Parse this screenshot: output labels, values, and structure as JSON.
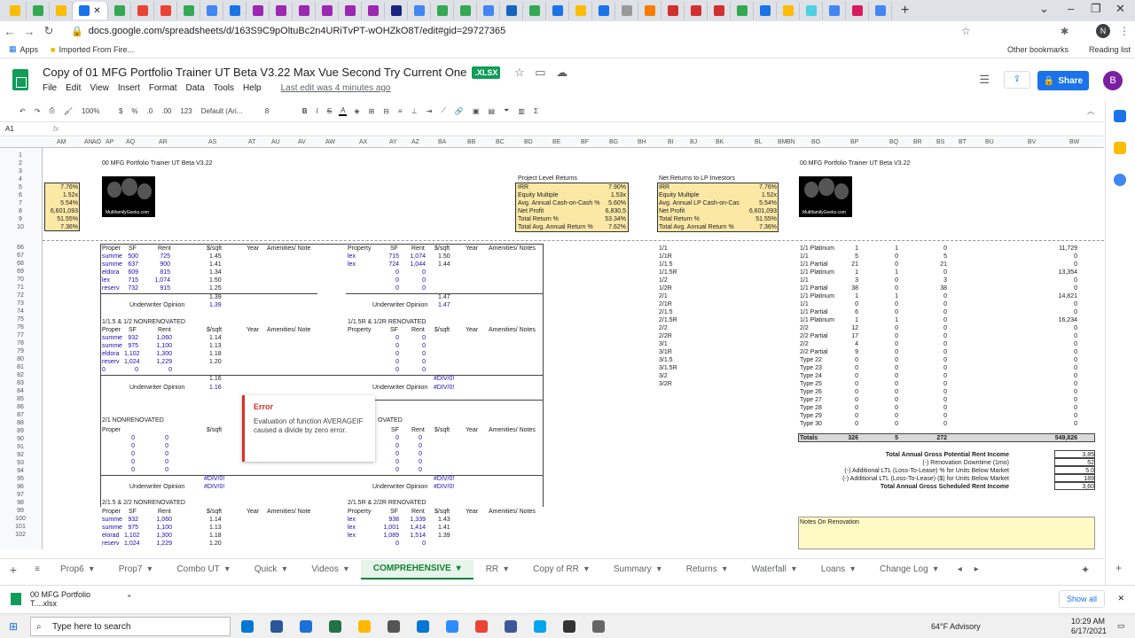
{
  "browser": {
    "active_tab_close": "✕",
    "new_tab": "+",
    "url": "docs.google.com/spreadsheets/d/163S9C9pOltuBc2n4URiTvPT-wOHZkO8T/edit#gid=29727365",
    "bookmarks": [
      "Apps",
      "Imported From Fire..."
    ],
    "other_bookmarks": "Other bookmarks",
    "reading_list": "Reading list",
    "profile": "N"
  },
  "doc": {
    "title": "Copy of 01 MFG Portfolio Trainer UT Beta V3.22 Max Vue Second Try Current One",
    "badge": ".XLSX",
    "menus": [
      "File",
      "Edit",
      "View",
      "Insert",
      "Format",
      "Data",
      "Tools",
      "Help"
    ],
    "last_edit": "Last edit was 4 minutes ago",
    "share": "Share",
    "avatar": "B"
  },
  "toolbar": {
    "zoom": "100%",
    "currency": "$",
    "percent": "%",
    "dec_less": ".0",
    "dec_more": ".00",
    "format": "123",
    "font": "Default (Ari...",
    "size": "8",
    "bold": "B",
    "italic": "I",
    "strike": "S",
    "color": "A"
  },
  "formula": {
    "cell": "A1",
    "fx": "fx"
  },
  "columns": [
    "AM",
    "AN",
    "AO",
    "AP",
    "AQ",
    "AR",
    "AS",
    "AT",
    "AU",
    "AV",
    "AW",
    "AX",
    "AY",
    "AZ",
    "BA",
    "BB",
    "BC",
    "BD",
    "BE",
    "BF",
    "BG",
    "BH",
    "BI",
    "BJ",
    "BK",
    "BL",
    "BM",
    "BN",
    "BO",
    "BP",
    "BQ",
    "BR",
    "BS",
    "BT",
    "BU",
    "BV",
    "BW"
  ],
  "rows": [
    "1",
    "2",
    "3",
    "4",
    "5",
    "6",
    "7",
    "8",
    "9",
    "10",
    "66",
    "67",
    "68",
    "69",
    "70",
    "71",
    "72",
    "73",
    "74",
    "75",
    "76",
    "77",
    "78",
    "79",
    "80",
    "81",
    "82",
    "83",
    "84",
    "85",
    "86",
    "87",
    "88",
    "89",
    "90",
    "91",
    "92",
    "93",
    "94",
    "95",
    "96",
    "97",
    "98",
    "99",
    "100",
    "101",
    "102"
  ],
  "header_title_left": "00 MFG Portfolio Trainer UT Beta V3.22",
  "header_title_right": "00 MFG Portfolio Trainer UT Beta V3.22",
  "left_metrics": [
    "7.76%",
    "1.52x",
    "5.54%",
    "6,601,093",
    "51.55%",
    "7.36%"
  ],
  "project_returns": {
    "title": "Project Level Returns",
    "rows": [
      [
        "IRR",
        "7.90%"
      ],
      [
        "Equity Multiple",
        "1.53x"
      ],
      [
        "Avg. Annual Cash-on-Cash %",
        "5.60%"
      ],
      [
        "Net Profit",
        "6,830,5"
      ],
      [
        "Total Return %",
        "53.34%"
      ],
      [
        "Total Avg. Annual Return %",
        "7.62%"
      ]
    ]
  },
  "lp_returns": {
    "title": "Net Returns to LP Investors",
    "rows": [
      [
        "IRR",
        "7.76%"
      ],
      [
        "Equity Multiple",
        "1.52x"
      ],
      [
        "Avg. Annual LP Cash-on-Cas",
        "5.54%"
      ],
      [
        "Net Profit",
        "6,601,093"
      ],
      [
        "Total Return %",
        "51.55%"
      ],
      [
        "Total Avg. Annual Return %",
        "7.36%"
      ]
    ]
  },
  "logo_text": "MultifamilyGeeks.com",
  "hdr": {
    "prop": "Proper",
    "property": "Property",
    "sf": "SF",
    "rent": "Rent",
    "psf": "$/sqft",
    "year": "Year",
    "amen": "Amenities/ Notes",
    "amen_short": "Amenities/ Note",
    "uw": "Underwriter Opinion"
  },
  "block1": {
    "rows": [
      [
        "summe",
        "500",
        "725",
        "1.45"
      ],
      [
        "summe",
        "637",
        "900",
        "1.41"
      ],
      [
        "eldora",
        "609",
        "815",
        "1.34"
      ],
      [
        "lex",
        "715",
        "1,074",
        "1.50"
      ],
      [
        "reserv",
        "732",
        "915",
        "1.25"
      ]
    ],
    "avg": "1.39",
    "uw": "1.39"
  },
  "block1r": {
    "rows": [
      [
        "lex",
        "715",
        "1,074",
        "1.50"
      ],
      [
        "lex",
        "724",
        "1,044",
        "1.44"
      ],
      [
        "",
        "0",
        "0",
        ""
      ],
      [
        "",
        "0",
        "0",
        ""
      ],
      [
        "",
        "0",
        "0",
        ""
      ]
    ],
    "avg": "1.47",
    "uw": "1.47"
  },
  "block2": {
    "title": "1/1.5 & 1/2 NONRENOVATED",
    "rows": [
      [
        "summe",
        "932",
        "1,060",
        "1.14"
      ],
      [
        "summe",
        "975",
        "1,100",
        "1.13"
      ],
      [
        "eldora",
        "1,102",
        "1,300",
        "1.18"
      ],
      [
        "reserv",
        "1,024",
        "1,229",
        "1.20"
      ],
      [
        "0",
        "0",
        "0",
        ""
      ]
    ],
    "avg": "1.16",
    "uw": "1.16"
  },
  "block2r": {
    "title": "1/1.5R & 1/2R RENOVATED",
    "rows": [
      [
        "",
        "0",
        "0"
      ],
      [
        "",
        "0",
        "0"
      ],
      [
        "",
        "0",
        "0"
      ],
      [
        "",
        "0",
        "0"
      ],
      [
        "",
        "0",
        "0"
      ]
    ],
    "avg": "#DIV/0!",
    "uw": "#DIV/0!"
  },
  "block3": {
    "title": "2/1 NONRENOVATED",
    "rows": [
      [
        "0",
        "0"
      ],
      [
        "0",
        "0"
      ],
      [
        "0",
        "0"
      ],
      [
        "0",
        "0"
      ],
      [
        "0",
        "0"
      ]
    ],
    "avg": "#DIV/0!",
    "uw": "#DIV/0!"
  },
  "block3r": {
    "title": "OVATED",
    "rows": [
      [
        "",
        "0",
        "0"
      ],
      [
        "",
        "0",
        "0"
      ],
      [
        "",
        "0",
        "0"
      ],
      [
        "",
        "0",
        "0"
      ],
      [
        "",
        "0",
        "0"
      ]
    ],
    "avg": "#DIV/0!",
    "uw": "#DIV/0!"
  },
  "block4": {
    "title": "2/1.5 & 2/2 NONRENOVATED",
    "rows": [
      [
        "summe",
        "932",
        "1,060",
        "1.14"
      ],
      [
        "summe",
        "975",
        "1,100",
        "1.13"
      ],
      [
        "elorad",
        "1,102",
        "1,300",
        "1.18"
      ],
      [
        "reserv",
        "1,024",
        "1,229",
        "1.20"
      ]
    ]
  },
  "block4r": {
    "title": "2/1.5R & 2/2R RENOVATED",
    "rows": [
      [
        "lex",
        "938",
        "1,339",
        "1.43"
      ],
      [
        "lex",
        "1,001",
        "1,414",
        "1.41"
      ],
      [
        "lex",
        "1,089",
        "1,514",
        "1.39"
      ],
      [
        "",
        "0",
        "0",
        ""
      ]
    ]
  },
  "unit_types": [
    "1/1",
    "1/1R",
    "1/1.5",
    "1/1.5R",
    "1/2",
    "1/2R",
    "2/1",
    "2/1R",
    "2/1.5",
    "2/1.5R",
    "2/2",
    "2/2R",
    "3/1",
    "3/1R",
    "3/1.5",
    "3/1.5R",
    "3/2",
    "3/2R"
  ],
  "right_table": [
    [
      "1/1 Platinum",
      "1",
      "1",
      "0",
      "11,729"
    ],
    [
      "1/1",
      "5",
      "0",
      "5",
      "0"
    ],
    [
      "1/1 Partial",
      "21",
      "0",
      "21",
      "0"
    ],
    [
      "1/1 Platinum",
      "1",
      "1",
      "0",
      "13,354"
    ],
    [
      "1/1",
      "3",
      "0",
      "3",
      "0"
    ],
    [
      "1/1 Partial",
      "38",
      "0",
      "38",
      "0"
    ],
    [
      "1/1 Platinum",
      "1",
      "1",
      "0",
      "14,821"
    ],
    [
      "1/1",
      "0",
      "0",
      "0",
      "0"
    ],
    [
      "1/1 Partial",
      "6",
      "0",
      "0",
      "0"
    ],
    [
      "1/1 Platinum",
      "1",
      "1",
      "0",
      "16,234"
    ],
    [
      "2/2",
      "12",
      "0",
      "0",
      "0"
    ],
    [
      "2/2 Partial",
      "17",
      "0",
      "0",
      "0"
    ],
    [
      "2/2",
      "4",
      "0",
      "0",
      "0"
    ],
    [
      "2/2 Partial",
      "9",
      "0",
      "0",
      "0"
    ],
    [
      "Type 22",
      "0",
      "0",
      "0",
      "0"
    ],
    [
      "Type 23",
      "0",
      "0",
      "0",
      "0"
    ],
    [
      "Type 24",
      "0",
      "0",
      "0",
      "0"
    ],
    [
      "Type 25",
      "0",
      "0",
      "0",
      "0"
    ],
    [
      "Type 26",
      "0",
      "0",
      "0",
      "0"
    ],
    [
      "Type 27",
      "0",
      "0",
      "0",
      "0"
    ],
    [
      "Type 28",
      "0",
      "0",
      "0",
      "0"
    ],
    [
      "Type 29",
      "0",
      "0",
      "0",
      "0"
    ],
    [
      "Type 30",
      "0",
      "0",
      "0",
      "0"
    ]
  ],
  "totals": [
    "Totals",
    "326",
    "5",
    "272",
    "549,826"
  ],
  "income": [
    [
      "Total Annual Gross Potential Rent Income",
      "3,85"
    ],
    [
      "(-) Renovation Downtime (1mo)",
      "52"
    ],
    [
      "(-) Additional LTL (Loss-To-Lease) % for Units Below Market",
      "5.0"
    ],
    [
      "(-) Additional LTL (Loss-To-Lease) ($) for Units Below Market",
      "189"
    ],
    [
      "Total Annual Gross Scheduled Rent Income",
      "3,60"
    ]
  ],
  "notes_label": "Notes On Renovation",
  "tooltip": {
    "title": "Error",
    "body": "Evaluation of function AVERAGEIF caused a divide by zero error."
  },
  "sheet_tabs": [
    "Prop6",
    "Prop7",
    "Combo UT",
    "Quick",
    "Videos",
    "COMPREHENSIVE",
    "RR",
    "Copy of RR",
    "Summary",
    "Returns",
    "Waterfall",
    "Loans",
    "Change Log"
  ],
  "active_sheet": "COMPREHENSIVE",
  "download": {
    "file": "00 MFG Portfolio T....xlsx",
    "show_all": "Show all"
  },
  "taskbar": {
    "search": "Type here to search",
    "weather": "64°F  Advisory",
    "time": "10:29 AM",
    "date": "6/17/2021"
  },
  "colors": {
    "accent_green": "#0f9d58",
    "share_blue": "#1a73e8",
    "yellow_box": "#fce8a5",
    "error_red": "#d93025"
  }
}
